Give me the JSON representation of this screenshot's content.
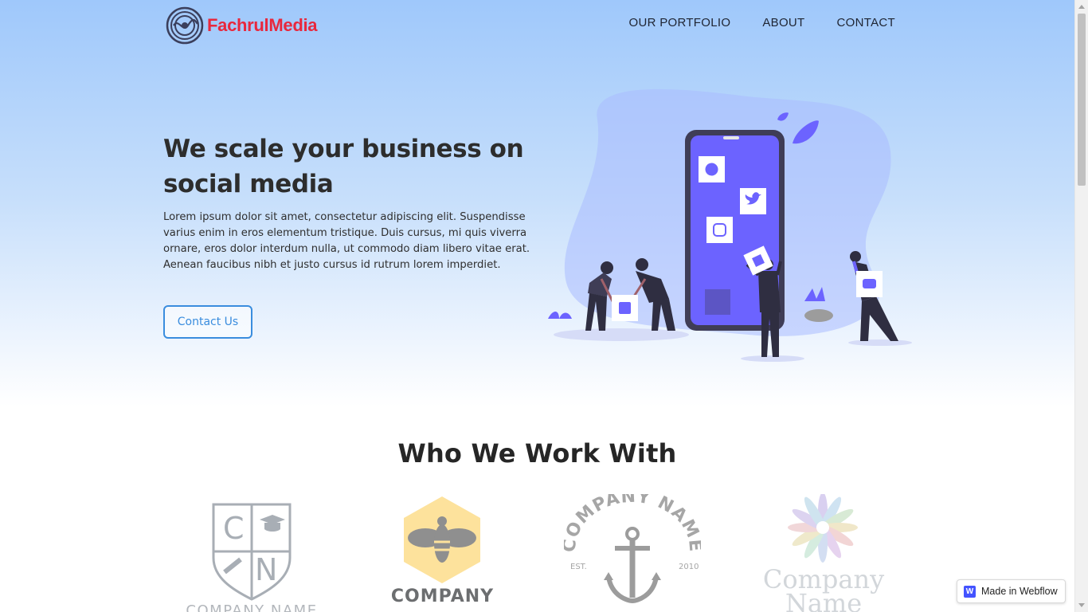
{
  "header": {
    "brand": "FachrulMedia",
    "nav": [
      "OUR PORTFOLIO",
      "ABOUT",
      "CONTACT"
    ]
  },
  "hero": {
    "title": "We scale your business on social media",
    "body": "Lorem ipsum dolor sit amet, consectetur adipiscing elit. Suspendisse varius enim in eros elementum tristique. Duis cursus, mi quis viverra ornare, eros dolor interdum nulla, ut commodo diam libero vitae erat. Aenean faucibus nibh et justo cursus id rutrum lorem imperdiet.",
    "cta": "Contact Us"
  },
  "clients": {
    "title": "Who We Work With",
    "logos": [
      {
        "icon": "shield-crest-icon",
        "letters": [
          "C",
          "N"
        ],
        "label": "COMPANY NAME"
      },
      {
        "icon": "bee-hexagon-icon",
        "label": "COMPANY"
      },
      {
        "icon": "anchor-badge-icon",
        "arc_text": "COMPANY NAME",
        "est": "EST.",
        "year": "2010"
      },
      {
        "icon": "flower-icon",
        "label": "Company Name"
      }
    ]
  },
  "badge": {
    "icon": "W",
    "label": "Made in Webflow"
  },
  "colors": {
    "brand_red": "#e8283d",
    "accent_blue": "#3a8dde",
    "illustration_purple": "#6c63ff"
  }
}
